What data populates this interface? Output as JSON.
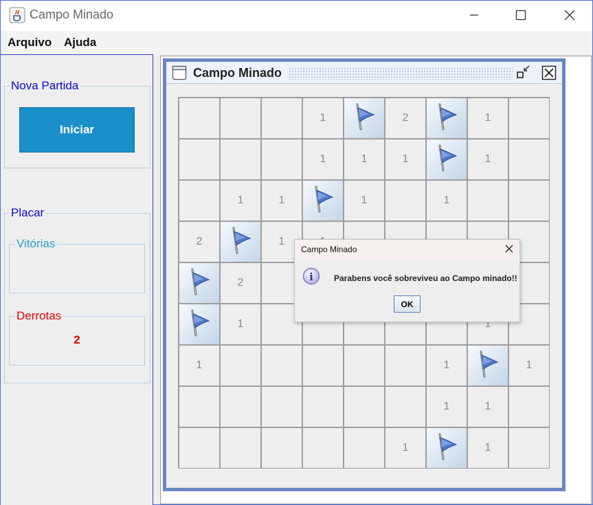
{
  "window": {
    "title": "Campo Minado",
    "icon": "java-cup-icon",
    "controls": [
      "minimize-icon",
      "maximize-icon",
      "close-icon"
    ]
  },
  "menu": {
    "items": [
      {
        "label": "Arquivo"
      },
      {
        "label": "Ajuda"
      }
    ]
  },
  "sidebar": {
    "nova_partida": {
      "legend": "Nova Partida",
      "button_label": "Iniciar"
    },
    "placar": {
      "legend": "Placar",
      "vitorias": {
        "legend": "Vitórias",
        "value": ""
      },
      "derrotas": {
        "legend": "Derrotas",
        "value": "2"
      }
    }
  },
  "game_frame": {
    "title": "Campo Minado",
    "icons": [
      "frame-icon",
      "iconify-icon",
      "close-icon"
    ]
  },
  "board": {
    "rows": [
      [
        "",
        "",
        "",
        "1",
        "F",
        "2",
        "F",
        "1",
        ""
      ],
      [
        "",
        "",
        "",
        "1",
        "1",
        "1",
        "F",
        "1",
        ""
      ],
      [
        "",
        "1",
        "1",
        "F",
        "1",
        "",
        "1",
        "",
        ""
      ],
      [
        "2",
        "F",
        "1",
        "1",
        "",
        "",
        "",
        "",
        ""
      ],
      [
        "F",
        "2",
        "",
        "",
        "",
        "",
        "",
        "",
        ""
      ],
      [
        "F",
        "1",
        "",
        "",
        "",
        "",
        "",
        "1",
        ""
      ],
      [
        "1",
        "",
        "",
        "",
        "",
        "",
        "1",
        "F",
        "1"
      ],
      [
        "",
        "",
        "",
        "",
        "",
        "",
        "1",
        "1",
        ""
      ],
      [
        "",
        "",
        "",
        "",
        "",
        "1",
        "F",
        "1",
        ""
      ]
    ]
  },
  "dialog": {
    "title": "Campo Minado",
    "icon": "info-icon",
    "message": "Parabens você sobreviveu ao Campo minado!!",
    "ok_label": "OK"
  },
  "colors": {
    "accent_button": "#1b8fca",
    "legend_blue": "#0a0acc",
    "legend_cyan": "#2a9fd0",
    "legend_red": "#e00000",
    "frame_border": "#6a85c6"
  }
}
